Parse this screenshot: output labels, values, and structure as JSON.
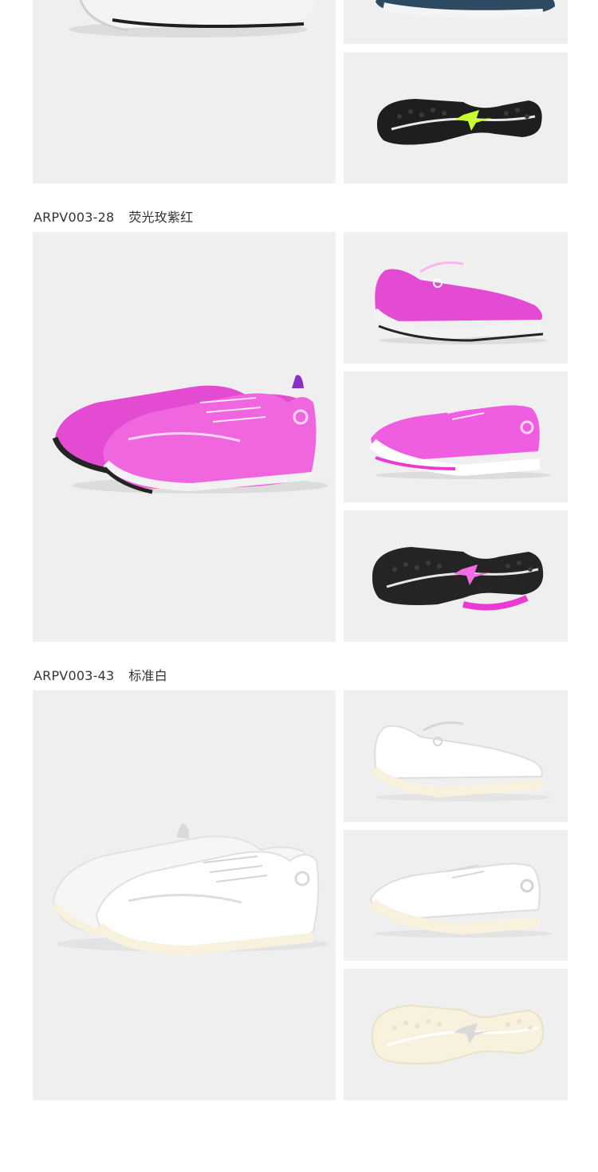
{
  "sections": [
    {
      "code": "",
      "color_name": "",
      "colors": {
        "upper": "#2c4a62",
        "upper_light": "#3f6482",
        "sole": "#f4f4f4",
        "outsole": "#1e1e1e",
        "accent": "#c7ff2e"
      }
    },
    {
      "code": "ARPV003-28",
      "color_name": "荧光玫紫红",
      "colors": {
        "upper": "#e44bd3",
        "upper_light": "#f47be6",
        "sole": "#f2f2f2",
        "outsole": "#242424",
        "accent": "#e93ad2"
      }
    },
    {
      "code": "ARPV003-43",
      "color_name": "标准白",
      "colors": {
        "upper": "#f6f6f6",
        "upper_light": "#ffffff",
        "sole": "#f7f1de",
        "outsole": "#e9e2c7",
        "accent": "#d9d9d9"
      }
    }
  ],
  "icons": {
    "main": "sneaker-pair-image",
    "side_lateral": "sneaker-side-view-image",
    "side_medial": "sneaker-medial-view-image",
    "outsole": "sneaker-outsole-image"
  }
}
